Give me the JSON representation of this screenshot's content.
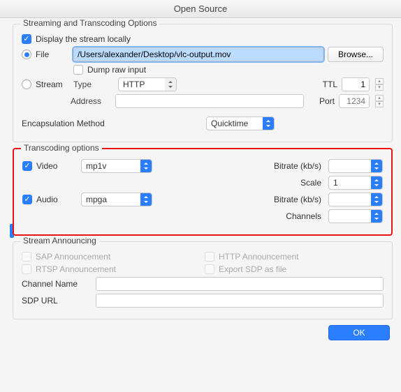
{
  "window": {
    "title": "Open Source"
  },
  "streaming": {
    "legend": "Streaming and Transcoding Options",
    "display_locally_label": "Display the stream locally",
    "display_locally_checked": true,
    "file_label": "File",
    "file_selected": true,
    "file_path": "/Users/alexander/Desktop/vlc-output.mov",
    "browse_label": "Browse...",
    "dump_label": "Dump raw input",
    "dump_checked": false,
    "stream_label": "Stream",
    "stream_selected": false,
    "type_label": "Type",
    "type_value": "HTTP",
    "ttl_label": "TTL",
    "ttl_value": "1",
    "address_label": "Address",
    "address_value": "",
    "port_label": "Port",
    "port_placeholder": "1234",
    "encapsulation_label": "Encapsulation Method",
    "encapsulation_value": "Quicktime"
  },
  "transcoding": {
    "legend": "Transcoding options",
    "video_label": "Video",
    "video_checked": true,
    "video_codec": "mp1v",
    "video_bitrate_label": "Bitrate (kb/s)",
    "video_bitrate_value": "",
    "scale_label": "Scale",
    "scale_value": "1",
    "audio_label": "Audio",
    "audio_checked": true,
    "audio_codec": "mpga",
    "audio_bitrate_label": "Bitrate (kb/s)",
    "audio_bitrate_value": "",
    "channels_label": "Channels",
    "channels_value": ""
  },
  "announce": {
    "legend": "Stream Announcing",
    "sap_label": "SAP Announcement",
    "rtsp_label": "RTSP Announcement",
    "http_label": "HTTP Announcement",
    "export_label": "Export SDP as file",
    "channel_name_label": "Channel Name",
    "channel_name_value": "",
    "sdp_url_label": "SDP URL",
    "sdp_url_value": ""
  },
  "footer": {
    "ok_label": "OK"
  }
}
